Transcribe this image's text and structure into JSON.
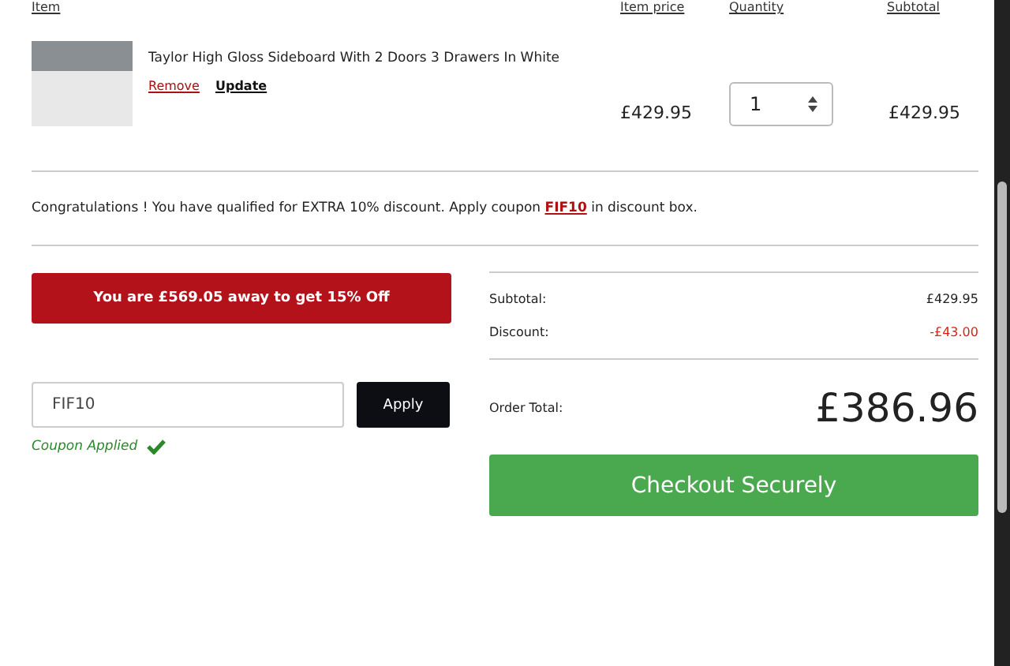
{
  "table": {
    "columns": [
      "Item",
      "Item price",
      "Quantity",
      "Subtotal"
    ],
    "rows": [
      {
        "name": "Taylor High Gloss Sideboard With 2 Doors 3 Drawers In White",
        "remove": "Remove",
        "update": "Update",
        "price": "£429.95",
        "quantity": "1",
        "subtotal": "£429.95"
      }
    ]
  },
  "promo_message": "Congratulations ! You have qualified for EXTRA 10% discount. Apply coupon **FIF10** in discount box.",
  "threshold_banner": "You are £569.05 away to get 15% Off",
  "coupon": {
    "value": "FIF10",
    "button": "Apply",
    "status": "Coupon Applied",
    "applied": true
  },
  "summary": [
    {
      "kind": "subtotal",
      "label": "Subtotal:",
      "value": "£429.95"
    },
    {
      "kind": "discount",
      "label": "Discount:",
      "value": "-£43.00"
    }
  ],
  "order_total": {
    "label": "Order Total:",
    "value": "£386.96"
  },
  "checkout_button": "Checkout Securely"
}
